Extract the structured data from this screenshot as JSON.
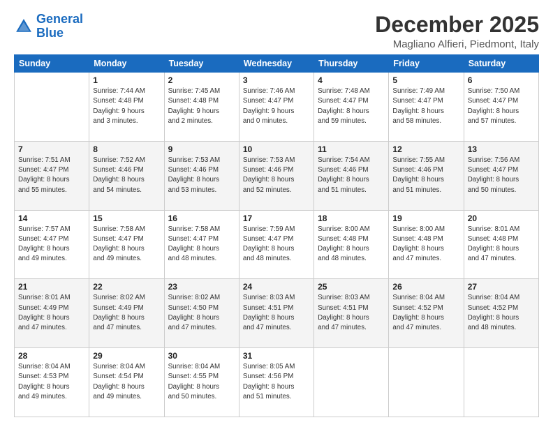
{
  "header": {
    "logo_general": "General",
    "logo_blue": "Blue",
    "month_title": "December 2025",
    "location": "Magliano Alfieri, Piedmont, Italy"
  },
  "days_of_week": [
    "Sunday",
    "Monday",
    "Tuesday",
    "Wednesday",
    "Thursday",
    "Friday",
    "Saturday"
  ],
  "weeks": [
    [
      {
        "day": "",
        "sunrise": "",
        "sunset": "",
        "daylight": ""
      },
      {
        "day": "1",
        "sunrise": "Sunrise: 7:44 AM",
        "sunset": "Sunset: 4:48 PM",
        "daylight": "Daylight: 9 hours and 3 minutes."
      },
      {
        "day": "2",
        "sunrise": "Sunrise: 7:45 AM",
        "sunset": "Sunset: 4:48 PM",
        "daylight": "Daylight: 9 hours and 2 minutes."
      },
      {
        "day": "3",
        "sunrise": "Sunrise: 7:46 AM",
        "sunset": "Sunset: 4:47 PM",
        "daylight": "Daylight: 9 hours and 0 minutes."
      },
      {
        "day": "4",
        "sunrise": "Sunrise: 7:48 AM",
        "sunset": "Sunset: 4:47 PM",
        "daylight": "Daylight: 8 hours and 59 minutes."
      },
      {
        "day": "5",
        "sunrise": "Sunrise: 7:49 AM",
        "sunset": "Sunset: 4:47 PM",
        "daylight": "Daylight: 8 hours and 58 minutes."
      },
      {
        "day": "6",
        "sunrise": "Sunrise: 7:50 AM",
        "sunset": "Sunset: 4:47 PM",
        "daylight": "Daylight: 8 hours and 57 minutes."
      }
    ],
    [
      {
        "day": "7",
        "sunrise": "Sunrise: 7:51 AM",
        "sunset": "Sunset: 4:47 PM",
        "daylight": "Daylight: 8 hours and 55 minutes."
      },
      {
        "day": "8",
        "sunrise": "Sunrise: 7:52 AM",
        "sunset": "Sunset: 4:46 PM",
        "daylight": "Daylight: 8 hours and 54 minutes."
      },
      {
        "day": "9",
        "sunrise": "Sunrise: 7:53 AM",
        "sunset": "Sunset: 4:46 PM",
        "daylight": "Daylight: 8 hours and 53 minutes."
      },
      {
        "day": "10",
        "sunrise": "Sunrise: 7:53 AM",
        "sunset": "Sunset: 4:46 PM",
        "daylight": "Daylight: 8 hours and 52 minutes."
      },
      {
        "day": "11",
        "sunrise": "Sunrise: 7:54 AM",
        "sunset": "Sunset: 4:46 PM",
        "daylight": "Daylight: 8 hours and 51 minutes."
      },
      {
        "day": "12",
        "sunrise": "Sunrise: 7:55 AM",
        "sunset": "Sunset: 4:46 PM",
        "daylight": "Daylight: 8 hours and 51 minutes."
      },
      {
        "day": "13",
        "sunrise": "Sunrise: 7:56 AM",
        "sunset": "Sunset: 4:47 PM",
        "daylight": "Daylight: 8 hours and 50 minutes."
      }
    ],
    [
      {
        "day": "14",
        "sunrise": "Sunrise: 7:57 AM",
        "sunset": "Sunset: 4:47 PM",
        "daylight": "Daylight: 8 hours and 49 minutes."
      },
      {
        "day": "15",
        "sunrise": "Sunrise: 7:58 AM",
        "sunset": "Sunset: 4:47 PM",
        "daylight": "Daylight: 8 hours and 49 minutes."
      },
      {
        "day": "16",
        "sunrise": "Sunrise: 7:58 AM",
        "sunset": "Sunset: 4:47 PM",
        "daylight": "Daylight: 8 hours and 48 minutes."
      },
      {
        "day": "17",
        "sunrise": "Sunrise: 7:59 AM",
        "sunset": "Sunset: 4:47 PM",
        "daylight": "Daylight: 8 hours and 48 minutes."
      },
      {
        "day": "18",
        "sunrise": "Sunrise: 8:00 AM",
        "sunset": "Sunset: 4:48 PM",
        "daylight": "Daylight: 8 hours and 48 minutes."
      },
      {
        "day": "19",
        "sunrise": "Sunrise: 8:00 AM",
        "sunset": "Sunset: 4:48 PM",
        "daylight": "Daylight: 8 hours and 47 minutes."
      },
      {
        "day": "20",
        "sunrise": "Sunrise: 8:01 AM",
        "sunset": "Sunset: 4:48 PM",
        "daylight": "Daylight: 8 hours and 47 minutes."
      }
    ],
    [
      {
        "day": "21",
        "sunrise": "Sunrise: 8:01 AM",
        "sunset": "Sunset: 4:49 PM",
        "daylight": "Daylight: 8 hours and 47 minutes."
      },
      {
        "day": "22",
        "sunrise": "Sunrise: 8:02 AM",
        "sunset": "Sunset: 4:49 PM",
        "daylight": "Daylight: 8 hours and 47 minutes."
      },
      {
        "day": "23",
        "sunrise": "Sunrise: 8:02 AM",
        "sunset": "Sunset: 4:50 PM",
        "daylight": "Daylight: 8 hours and 47 minutes."
      },
      {
        "day": "24",
        "sunrise": "Sunrise: 8:03 AM",
        "sunset": "Sunset: 4:51 PM",
        "daylight": "Daylight: 8 hours and 47 minutes."
      },
      {
        "day": "25",
        "sunrise": "Sunrise: 8:03 AM",
        "sunset": "Sunset: 4:51 PM",
        "daylight": "Daylight: 8 hours and 47 minutes."
      },
      {
        "day": "26",
        "sunrise": "Sunrise: 8:04 AM",
        "sunset": "Sunset: 4:52 PM",
        "daylight": "Daylight: 8 hours and 47 minutes."
      },
      {
        "day": "27",
        "sunrise": "Sunrise: 8:04 AM",
        "sunset": "Sunset: 4:52 PM",
        "daylight": "Daylight: 8 hours and 48 minutes."
      }
    ],
    [
      {
        "day": "28",
        "sunrise": "Sunrise: 8:04 AM",
        "sunset": "Sunset: 4:53 PM",
        "daylight": "Daylight: 8 hours and 49 minutes."
      },
      {
        "day": "29",
        "sunrise": "Sunrise: 8:04 AM",
        "sunset": "Sunset: 4:54 PM",
        "daylight": "Daylight: 8 hours and 49 minutes."
      },
      {
        "day": "30",
        "sunrise": "Sunrise: 8:04 AM",
        "sunset": "Sunset: 4:55 PM",
        "daylight": "Daylight: 8 hours and 50 minutes."
      },
      {
        "day": "31",
        "sunrise": "Sunrise: 8:05 AM",
        "sunset": "Sunset: 4:56 PM",
        "daylight": "Daylight: 8 hours and 51 minutes."
      },
      {
        "day": "",
        "sunrise": "",
        "sunset": "",
        "daylight": ""
      },
      {
        "day": "",
        "sunrise": "",
        "sunset": "",
        "daylight": ""
      },
      {
        "day": "",
        "sunrise": "",
        "sunset": "",
        "daylight": ""
      }
    ]
  ]
}
